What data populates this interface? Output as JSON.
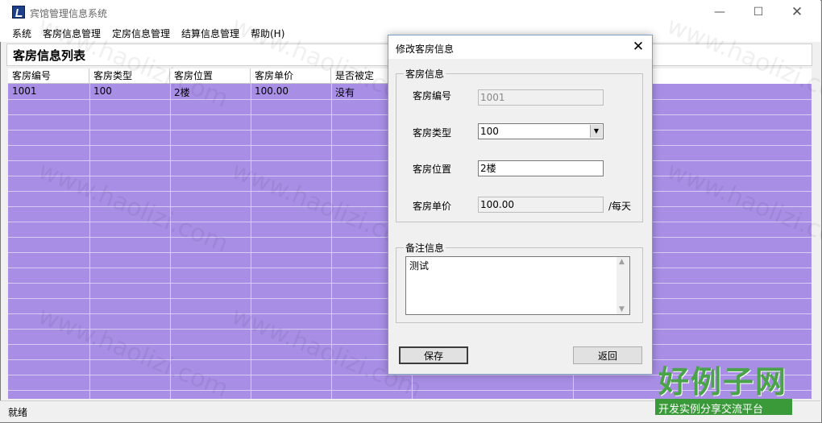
{
  "window": {
    "title": "宾馆管理信息系统",
    "icons": [
      "app-icon",
      "minimize-icon",
      "maximize-icon",
      "close-icon"
    ]
  },
  "menu": [
    "系统",
    "客房信息管理",
    "定房信息管理",
    "结算信息管理",
    "帮助(H)"
  ],
  "list": {
    "title": "客房信息列表",
    "columns": [
      "客房编号",
      "客房类型",
      "客房位置",
      "客房单价",
      "是否被定"
    ],
    "rows": [
      [
        "1001",
        "100",
        "2楼",
        "100.00",
        "没有"
      ]
    ]
  },
  "status": "就绪",
  "dialog": {
    "title": "修改客房信息",
    "group_room": "客房信息",
    "labels": {
      "room_no": "客房编号",
      "room_type": "客房类型",
      "room_location": "客房位置",
      "room_price": "客房单价"
    },
    "values": {
      "room_no": "1001",
      "room_type": "100",
      "room_location": "2楼",
      "room_price": "100.00"
    },
    "price_unit": "/每天",
    "group_note": "备注信息",
    "note": "测试",
    "save": "保存",
    "back": "返回"
  },
  "watermark": {
    "url": "www.haolizi.com",
    "logo": "好例子网",
    "slogan": "开发实例分享交流平台"
  },
  "colors": {
    "grid_bg": "#a98ee6",
    "dialog_border": "#7e9fc3",
    "logo_green": "#3a9a3a"
  }
}
